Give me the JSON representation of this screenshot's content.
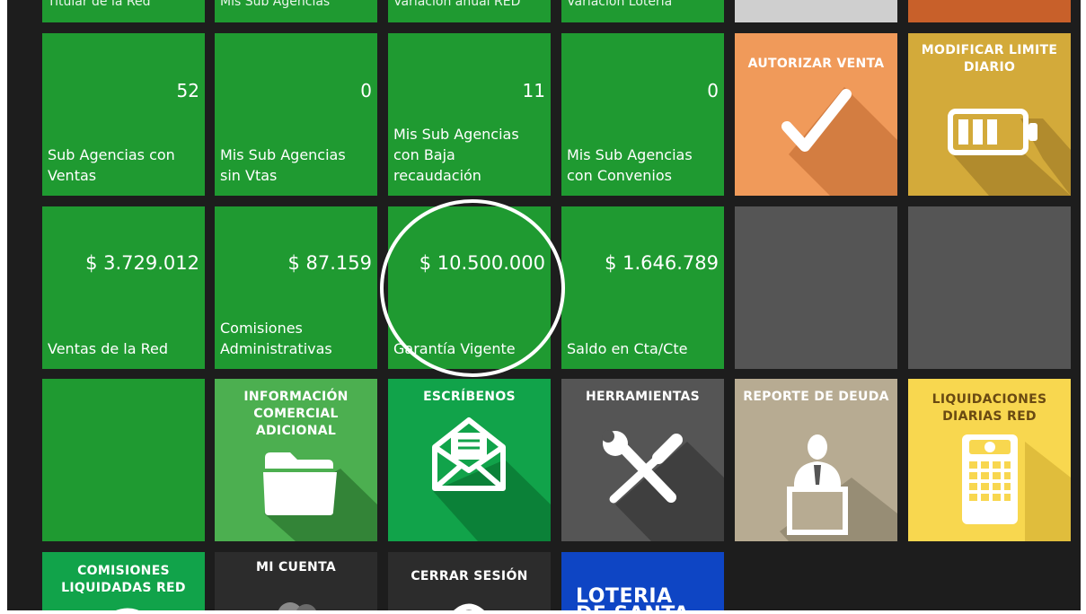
{
  "top_row": {
    "cut_labels": [
      "Titular de la Red",
      "Mis Sub Agencias",
      "Variación anual RED",
      "Variación Lotería"
    ]
  },
  "counts": [
    {
      "value": "52",
      "label": "Sub Agencias con Ventas"
    },
    {
      "value": "0",
      "label": "Mis Sub Agencias sin Vtas"
    },
    {
      "value": "11",
      "label": "Mis Sub Agencias con Baja recaudación"
    },
    {
      "value": "0",
      "label": "Mis Sub Agencias con Convenios"
    }
  ],
  "amounts": [
    {
      "value": "$ 3.729.012",
      "label": "Ventas de la Red"
    },
    {
      "value": "$ 87.159",
      "label": "Comisiones Administrativas"
    },
    {
      "value": "$ 10.500.000",
      "label": "Garantía Vigente"
    },
    {
      "value": "$ 1.646.789",
      "label": "Saldo en Cta/Cte"
    }
  ],
  "actions": {
    "autorizar": "AUTORIZAR VENTA",
    "modificar": "MODIFICAR LIMITE DIARIO",
    "informacion": "INFORMACIÓN COMERCIAL ADICIONAL",
    "escribenos": "ESCRÍBENOS",
    "herramientas": "HERRAMIENTAS",
    "reporte": "REPORTE DE DEUDA",
    "liquidaciones": "LIQUIDACIONES DIARIAS RED",
    "comisiones": "COMISIONES LIQUIDADAS RED",
    "mi_cuenta": "MI CUENTA",
    "cerrar": "CERRAR SESIÓN",
    "loteria": "LOTERIA DE SANTA FE"
  },
  "colors": {
    "green": "#1f9a31",
    "green_light": "#4caf50",
    "orange": "#f09a5a",
    "gold": "#d3aa3a",
    "gray": "#555555",
    "beige": "#b7ab92",
    "yellow": "#f8d74f",
    "blue": "#0e45c4"
  }
}
